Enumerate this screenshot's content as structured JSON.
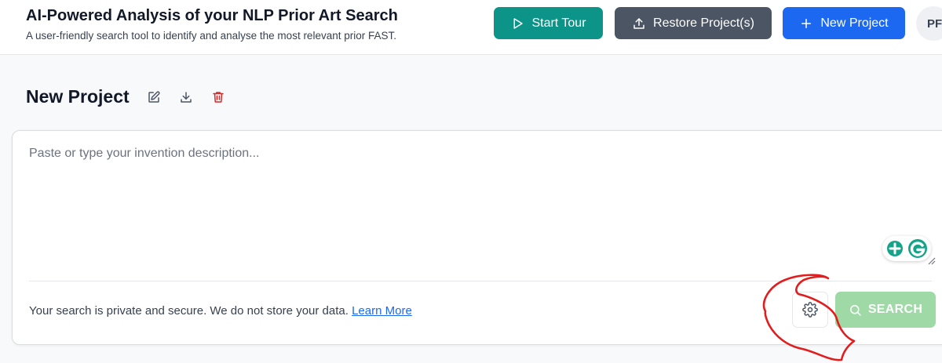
{
  "header": {
    "title": "AI-Powered Analysis of your NLP Prior Art Search",
    "subtitle": "A user-friendly search tool to identify and analyse the most relevant prior FAST.",
    "buttons": {
      "start_tour": "Start Tour",
      "restore_projects": "Restore Project(s)",
      "new_project": "New Project"
    },
    "avatar_initials": "PF"
  },
  "project": {
    "title": "New Project",
    "actions": [
      "edit-icon",
      "download-icon",
      "trash-icon"
    ]
  },
  "editor": {
    "placeholder": "Paste or type your invention description...",
    "value": ""
  },
  "footer": {
    "privacy_text": "Your search is private and secure. We do not store your data.",
    "learn_more": "Learn More",
    "search_label": "SEARCH"
  },
  "colors": {
    "teal": "#0d9488",
    "gray": "#4b5563",
    "blue": "#1d68f0",
    "search_disabled": "#9ed9a6",
    "delete_red": "#dc2626",
    "annotation_red": "#e11d1d"
  }
}
